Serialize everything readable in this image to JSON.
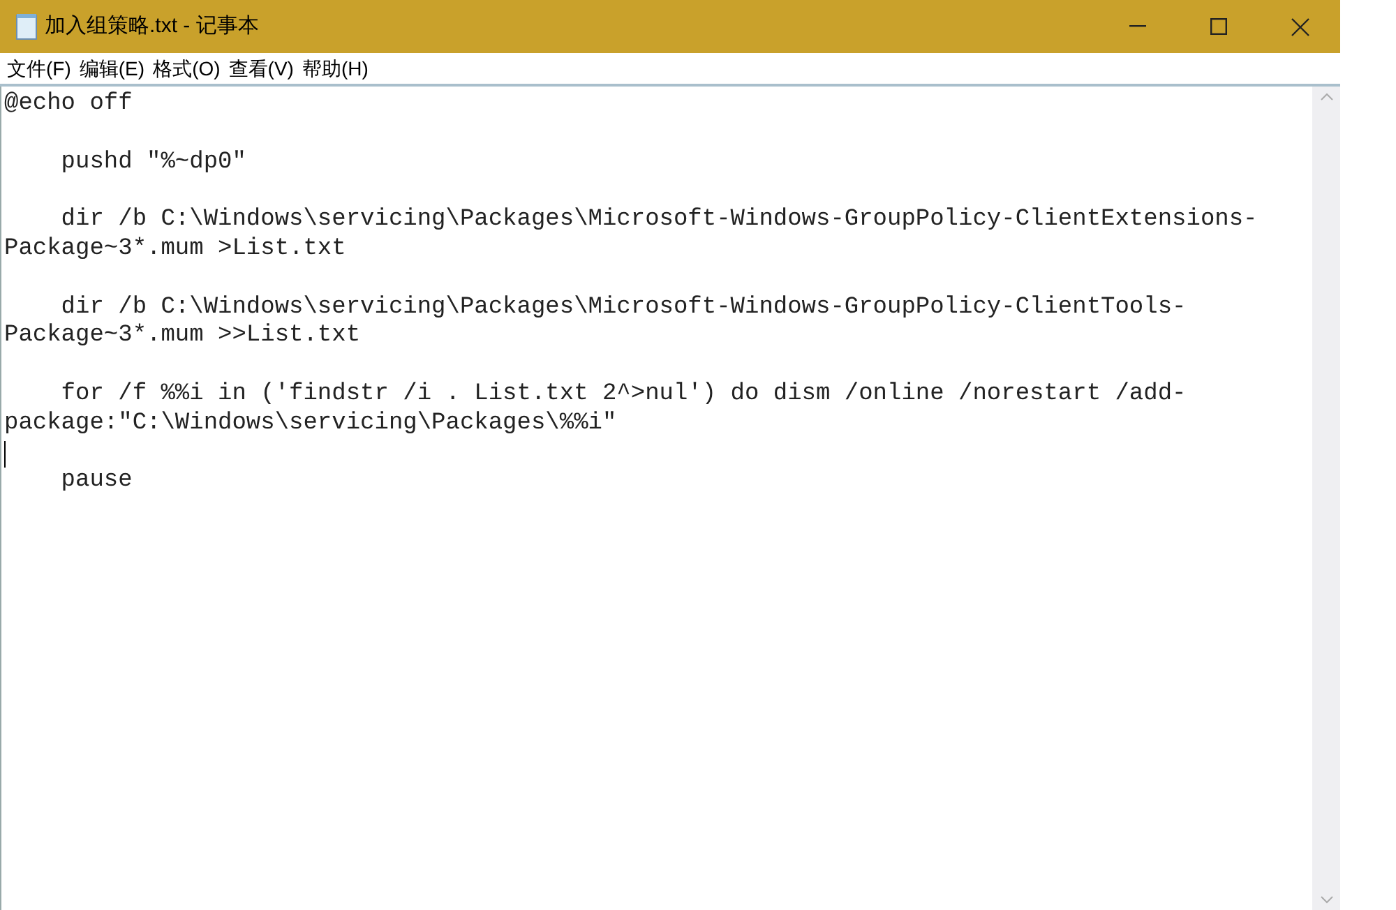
{
  "window": {
    "title": "加入组策略.txt - 记事本"
  },
  "menu": [
    "文件(F)",
    "编辑(E)",
    "格式(O)",
    "查看(V)",
    "帮助(H)"
  ],
  "editor": {
    "paragraphs": [
      {
        "lines": [
          "@echo off"
        ],
        "caret_after": false
      },
      {
        "lines": [
          "    pushd \"%~dp0\""
        ],
        "caret_after": false
      },
      {
        "lines": [
          "    dir /b C:\\Windows\\servicing\\Packages\\Microsoft-Windows-GroupPolicy-ClientExtensions-",
          "Package~3*.mum >List.txt"
        ],
        "caret_after": false
      },
      {
        "lines": [
          "    dir /b C:\\Windows\\servicing\\Packages\\Microsoft-Windows-GroupPolicy-ClientTools-",
          "Package~3*.mum >>List.txt"
        ],
        "caret_after": false
      },
      {
        "lines": [
          "    for /f %%i in ('findstr /i . List.txt 2^>nul') do dism /online /norestart /add-",
          "package:\"C:\\Windows\\servicing\\Packages\\%%i\""
        ],
        "caret_after": true
      },
      {
        "lines": [
          "    pause"
        ],
        "caret_after": false
      }
    ]
  }
}
